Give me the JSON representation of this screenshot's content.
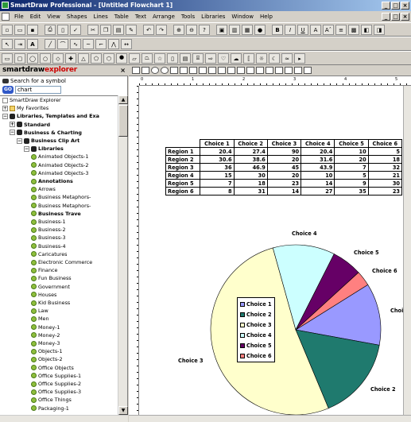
{
  "window": {
    "title": "SmartDraw Professional - [Untitled Flowchart 1]"
  },
  "menu": [
    "File",
    "Edit",
    "View",
    "Shapes",
    "Lines",
    "Table",
    "Text",
    "Arrange",
    "Tools",
    "Libraries",
    "Window",
    "Help"
  ],
  "explorer": {
    "brand_main": "smartdraw",
    "brand_accent": "explorer",
    "search_label": "Search for a symbol",
    "go_label": "GO",
    "search_value": "chart",
    "tree": [
      {
        "label": "SmartDraw Explorer",
        "icon": "doc",
        "indent": 0,
        "bold": false,
        "toggle": ""
      },
      {
        "label": "My Favorites",
        "icon": "fold",
        "indent": 0,
        "bold": false,
        "toggle": "+"
      },
      {
        "label": "Libraries, Templates and Exa",
        "icon": "bin",
        "indent": 0,
        "bold": true,
        "toggle": "−"
      },
      {
        "label": "Standard",
        "icon": "bin",
        "indent": 1,
        "bold": true,
        "toggle": "+"
      },
      {
        "label": "Business & Charting",
        "icon": "bin",
        "indent": 1,
        "bold": true,
        "toggle": "−"
      },
      {
        "label": "Business Clip Art",
        "icon": "bin",
        "indent": 2,
        "bold": true,
        "toggle": "−"
      },
      {
        "label": "Libraries",
        "icon": "bin",
        "indent": 3,
        "bold": true,
        "toggle": "−"
      },
      {
        "label": "Animated Objects-1",
        "icon": "lib",
        "indent": 4,
        "bold": false,
        "toggle": ""
      },
      {
        "label": "Animated Objects-2",
        "icon": "lib",
        "indent": 4,
        "bold": false,
        "toggle": ""
      },
      {
        "label": "Animated Objects-3",
        "icon": "lib",
        "indent": 4,
        "bold": false,
        "toggle": ""
      },
      {
        "label": "Annotations",
        "icon": "lib",
        "indent": 4,
        "bold": true,
        "toggle": ""
      },
      {
        "label": "Arrows",
        "icon": "lib",
        "indent": 4,
        "bold": false,
        "toggle": ""
      },
      {
        "label": "Business Metaphors-",
        "icon": "lib",
        "indent": 4,
        "bold": false,
        "toggle": ""
      },
      {
        "label": "Business Metaphors-",
        "icon": "lib",
        "indent": 4,
        "bold": false,
        "toggle": ""
      },
      {
        "label": "Business Trave",
        "icon": "lib",
        "indent": 4,
        "bold": true,
        "toggle": ""
      },
      {
        "label": "Business-1",
        "icon": "lib",
        "indent": 4,
        "bold": false,
        "toggle": ""
      },
      {
        "label": "Business-2",
        "icon": "lib",
        "indent": 4,
        "bold": false,
        "toggle": ""
      },
      {
        "label": "Business-3",
        "icon": "lib",
        "indent": 4,
        "bold": false,
        "toggle": ""
      },
      {
        "label": "Business-4",
        "icon": "lib",
        "indent": 4,
        "bold": false,
        "toggle": ""
      },
      {
        "label": "Caricatures",
        "icon": "lib",
        "indent": 4,
        "bold": false,
        "toggle": ""
      },
      {
        "label": "Electronic Commerce",
        "icon": "lib",
        "indent": 4,
        "bold": false,
        "toggle": ""
      },
      {
        "label": "Finance",
        "icon": "lib",
        "indent": 4,
        "bold": false,
        "toggle": ""
      },
      {
        "label": "Fun Business",
        "icon": "lib",
        "indent": 4,
        "bold": false,
        "toggle": ""
      },
      {
        "label": "Government",
        "icon": "lib",
        "indent": 4,
        "bold": false,
        "toggle": ""
      },
      {
        "label": "Houses",
        "icon": "lib",
        "indent": 4,
        "bold": false,
        "toggle": ""
      },
      {
        "label": "Kid Business",
        "icon": "lib",
        "indent": 4,
        "bold": false,
        "toggle": ""
      },
      {
        "label": "Law",
        "icon": "lib",
        "indent": 4,
        "bold": false,
        "toggle": ""
      },
      {
        "label": "Men",
        "icon": "lib",
        "indent": 4,
        "bold": false,
        "toggle": ""
      },
      {
        "label": "Money-1",
        "icon": "lib",
        "indent": 4,
        "bold": false,
        "toggle": ""
      },
      {
        "label": "Money-2",
        "icon": "lib",
        "indent": 4,
        "bold": false,
        "toggle": ""
      },
      {
        "label": "Money-3",
        "icon": "lib",
        "indent": 4,
        "bold": false,
        "toggle": ""
      },
      {
        "label": "Objects-1",
        "icon": "lib",
        "indent": 4,
        "bold": false,
        "toggle": ""
      },
      {
        "label": "Objects-2",
        "icon": "lib",
        "indent": 4,
        "bold": false,
        "toggle": ""
      },
      {
        "label": "Office Objects",
        "icon": "lib",
        "indent": 4,
        "bold": false,
        "toggle": ""
      },
      {
        "label": "Office Supplies-1",
        "icon": "lib",
        "indent": 4,
        "bold": false,
        "toggle": ""
      },
      {
        "label": "Office Supplies-2",
        "icon": "lib",
        "indent": 4,
        "bold": false,
        "toggle": ""
      },
      {
        "label": "Office Supplies-3",
        "icon": "lib",
        "indent": 4,
        "bold": false,
        "toggle": ""
      },
      {
        "label": "Office Things",
        "icon": "lib",
        "indent": 4,
        "bold": false,
        "toggle": ""
      },
      {
        "label": "Packaging-1",
        "icon": "lib",
        "indent": 4,
        "bold": false,
        "toggle": ""
      }
    ]
  },
  "ruler": [
    "0",
    "1",
    "2",
    "3",
    "4",
    "5"
  ],
  "table": {
    "columns": [
      "Choice 1",
      "Choice 2",
      "Choice 3",
      "Choice 4",
      "Choice 5",
      "Choice 6"
    ],
    "rows": [
      {
        "label": "Region 1",
        "values": [
          "20.4",
          "27.4",
          "90",
          "20.4",
          "10",
          "5"
        ]
      },
      {
        "label": "Region 2",
        "values": [
          "30.6",
          "38.6",
          "20",
          "31.6",
          "20",
          "18"
        ]
      },
      {
        "label": "Region 3",
        "values": [
          "36",
          "46.9",
          "45",
          "43.9",
          "7",
          "32"
        ]
      },
      {
        "label": "Region 4",
        "values": [
          "15",
          "30",
          "20",
          "10",
          "5",
          "21"
        ]
      },
      {
        "label": "Region 5",
        "values": [
          "7",
          "18",
          "23",
          "14",
          "9",
          "30"
        ]
      },
      {
        "label": "Region 6",
        "values": [
          "8",
          "31",
          "14",
          "27",
          "35",
          "23"
        ]
      }
    ]
  },
  "chart_data": {
    "type": "pie",
    "categories": [
      "Choice 1",
      "Choice 2",
      "Choice 3",
      "Choice 4",
      "Choice 5",
      "Choice 6"
    ],
    "values": [
      20.4,
      27.4,
      90,
      20.4,
      10,
      5
    ],
    "colors": [
      "#9999ff",
      "#1f7a6e",
      "#ffffcc",
      "#ccffff",
      "#660066",
      "#ff8080"
    ],
    "legend_position": "left"
  }
}
